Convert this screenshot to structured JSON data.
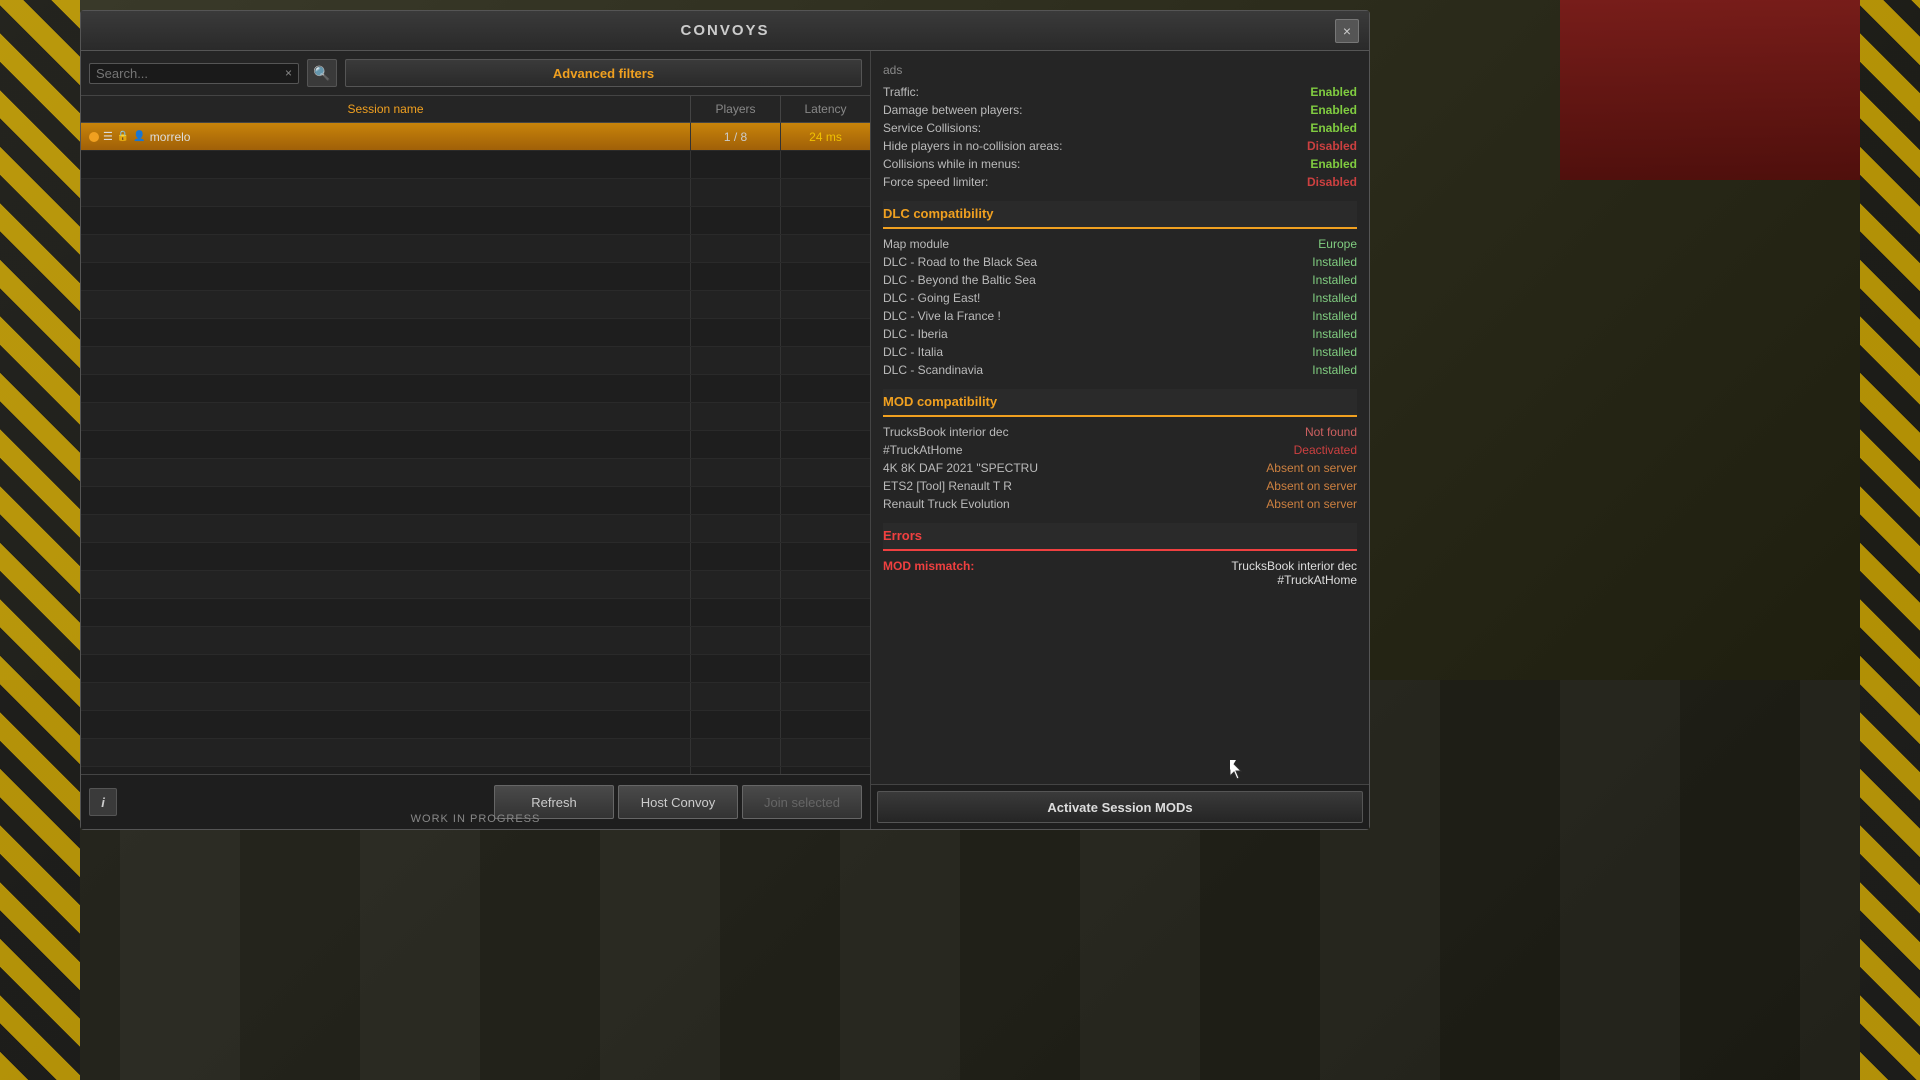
{
  "dialog": {
    "title": "CONVOYS",
    "close_label": "×"
  },
  "toolbar": {
    "search_placeholder": "Search...",
    "advanced_filters_label": "Advanced filters"
  },
  "table": {
    "headers": {
      "session_name": "Session name",
      "players": "Players",
      "latency": "Latency"
    }
  },
  "sessions": [
    {
      "id": 1,
      "active": true,
      "name": "morrelo",
      "players": "1 / 8",
      "latency": "24 ms",
      "latency_class": "yellow",
      "has_icon_circle": true,
      "has_icon_list": true,
      "has_icon_lock": true,
      "has_icon_user": true
    }
  ],
  "empty_rows": 24,
  "bottom": {
    "info_label": "i",
    "refresh_label": "Refresh",
    "host_convoy_label": "Host Convoy",
    "join_selected_label": "Join selected",
    "work_in_progress": "WORK IN PROGRESS"
  },
  "right_panel": {
    "ads_section": {
      "label": "ads",
      "rows": [
        {
          "key": "Traffic:",
          "val": "Enabled",
          "val_class": "green"
        },
        {
          "key": "Damage between players:",
          "val": "Enabled",
          "val_class": "green"
        },
        {
          "key": "Service Collisions:",
          "val": "Enabled",
          "val_class": "green"
        },
        {
          "key": "Hide players in no-collision areas:",
          "val": "Disabled",
          "val_class": "red"
        },
        {
          "key": "Collisions while in menus:",
          "val": "Enabled",
          "val_class": "green"
        },
        {
          "key": "Force speed limiter:",
          "val": "Disabled",
          "val_class": "red"
        }
      ]
    },
    "dlc_section": {
      "label": "DLC compatibility",
      "map_module_key": "Map module",
      "map_module_val": "Europe",
      "dlcs": [
        {
          "key": "DLC - Road to the Black Sea",
          "val": "Installed",
          "val_class": ""
        },
        {
          "key": "DLC - Beyond the Baltic Sea",
          "val": "Installed",
          "val_class": ""
        },
        {
          "key": "DLC - Going East!",
          "val": "Installed",
          "val_class": ""
        },
        {
          "key": "DLC - Vive la France !",
          "val": "Installed",
          "val_class": ""
        },
        {
          "key": "DLC - Iberia",
          "val": "Installed",
          "val_class": ""
        },
        {
          "key": "DLC - Italia",
          "val": "Installed",
          "val_class": ""
        },
        {
          "key": "DLC - Scandinavia",
          "val": "Installed",
          "val_class": ""
        }
      ]
    },
    "mod_section": {
      "label": "MOD compatibility",
      "mods": [
        {
          "key": "TrucksBook interior dec",
          "val": "Not found",
          "val_class": "notfound"
        },
        {
          "key": "#TruckAtHome",
          "val": "Deactivated",
          "val_class": "deactivated"
        },
        {
          "key": "4K 8K DAF 2021 \"SPECTRU",
          "val": "Absent on server",
          "val_class": "absent"
        },
        {
          "key": "ETS2 [Tool] Renault T R",
          "val": "Absent on server",
          "val_class": "absent"
        },
        {
          "key": "Renault Truck Evolution",
          "val": "Absent on server",
          "val_class": "absent"
        }
      ]
    },
    "errors_section": {
      "label": "Errors",
      "rows": [
        {
          "key": "MOD mismatch:",
          "val": "TrucksBook interior dec\n#TruckAtHome"
        }
      ]
    },
    "activate_btn_label": "Activate Session MODs"
  }
}
